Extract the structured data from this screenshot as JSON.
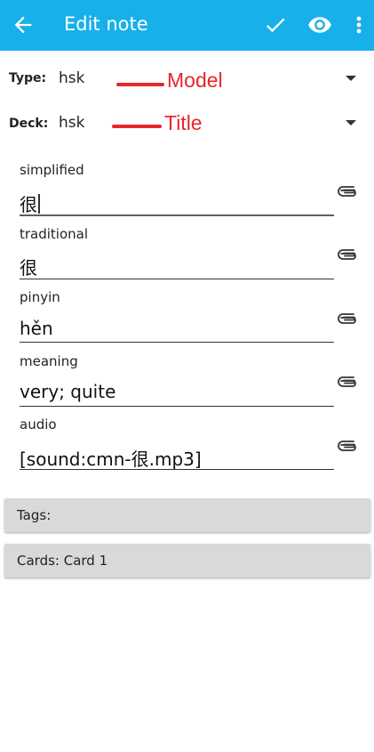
{
  "appbar": {
    "title": "Edit note",
    "icons": [
      "back-arrow-icon",
      "checkmark-icon",
      "eye-icon",
      "more-vert-icon"
    ],
    "color": "#17b0ea"
  },
  "note_type": {
    "label": "Type:",
    "value": "hsk"
  },
  "deck": {
    "label": "Deck:",
    "value": "hsk"
  },
  "annotations": {
    "model": "Model",
    "title": "Title",
    "color": "#e8262c"
  },
  "fields": [
    {
      "label": "simplified",
      "value": "很"
    },
    {
      "label": "traditional",
      "value": "很"
    },
    {
      "label": "pinyin",
      "value": "hěn"
    },
    {
      "label": "meaning",
      "value": "very; quite"
    },
    {
      "label": "audio",
      "value": "[sound:cmn-很.mp3]"
    }
  ],
  "tags": {
    "label": "Tags:"
  },
  "cards": {
    "label": "Cards: Card 1"
  }
}
